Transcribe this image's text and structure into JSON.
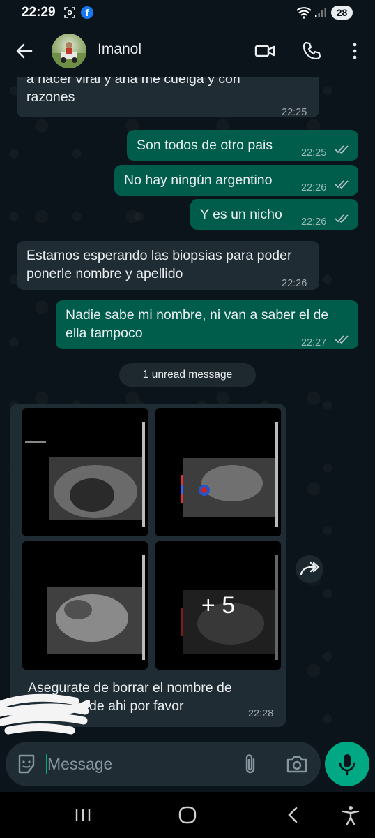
{
  "status_bar": {
    "time": "22:29",
    "battery": "28"
  },
  "header": {
    "contact_name": "Imanol"
  },
  "messages": [
    {
      "side": "in",
      "text": "a hacer viral y ana me cuelga y con razones",
      "time": "22:25"
    },
    {
      "side": "out",
      "text": "Son todos de otro pais",
      "time": "22:25"
    },
    {
      "side": "out",
      "text": "No hay ningún argentino",
      "time": "22:26"
    },
    {
      "side": "out",
      "text": "Y es un nicho",
      "time": "22:26"
    },
    {
      "side": "in",
      "text": "Estamos esperando las biopsias para poder ponerle nombre y apellido",
      "time": "22:26"
    },
    {
      "side": "out",
      "text": "Nadie sabe mi nombre, ni van a saber el de ella tampoco",
      "time": "22:27"
    }
  ],
  "unread_label": "1 unread message",
  "image_message": {
    "more_count": "+ 5",
    "caption_line1": "Asegurate de borrar el nombre de",
    "caption_line2": "de ahi por favor",
    "time": "22:28"
  },
  "composer": {
    "placeholder": "Message"
  },
  "colors": {
    "incoming": "#202c33",
    "outgoing": "#005c4b",
    "accent": "#00a884",
    "background": "#0b141a"
  }
}
